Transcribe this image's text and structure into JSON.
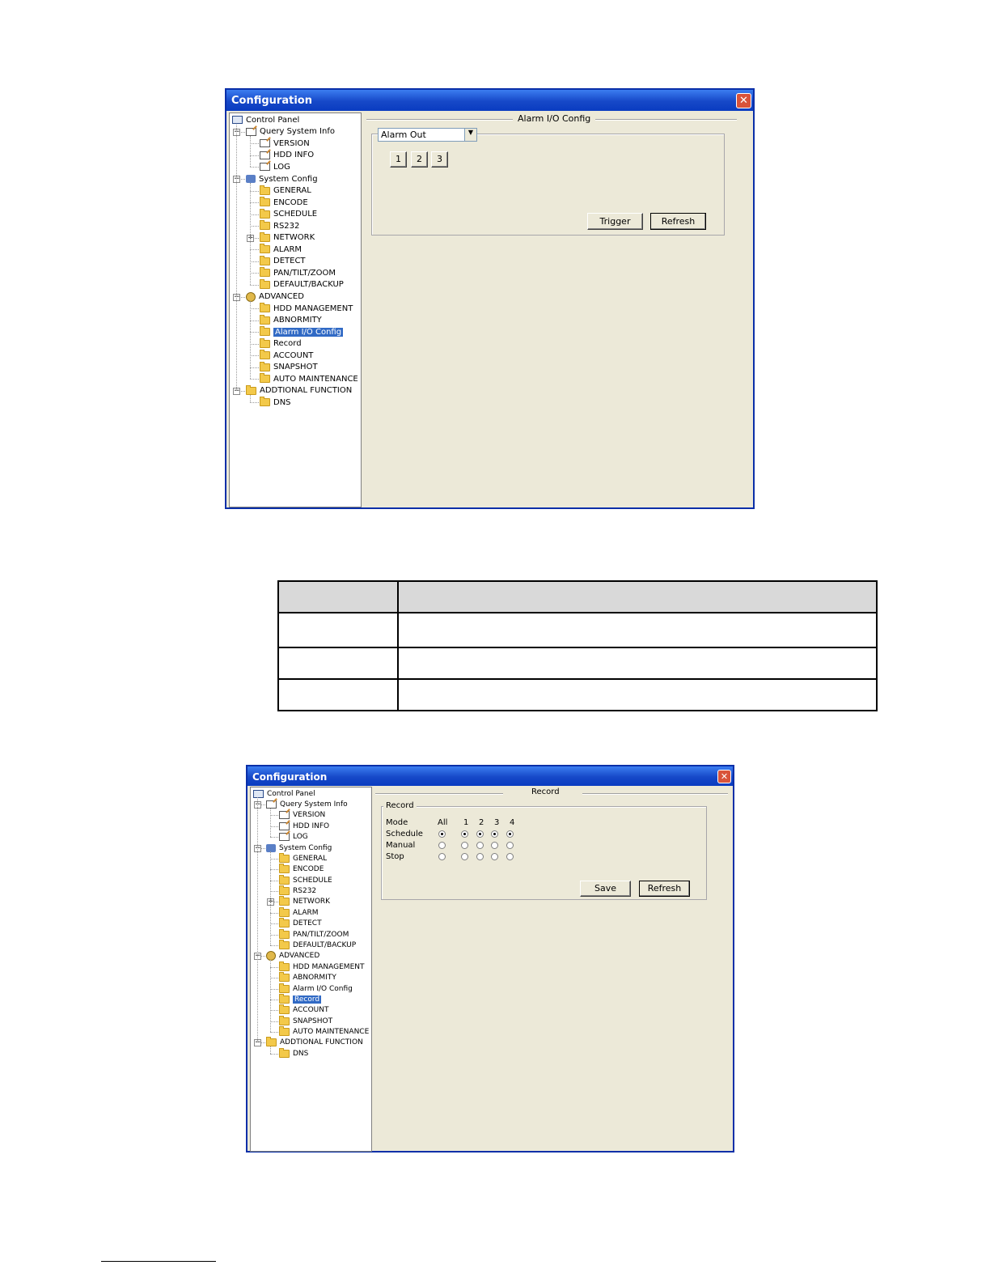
{
  "window1": {
    "title": "Configuration",
    "section_title": "Alarm I/O Config",
    "select_value": "Alarm Out",
    "channel_buttons": [
      "1",
      "2",
      "3"
    ],
    "trigger_label": "Trigger",
    "refresh_label": "Refresh"
  },
  "window2": {
    "title": "Configuration",
    "section_title": "Record",
    "group_label": "Record",
    "col_headers": [
      "Mode",
      "All",
      "1",
      "2",
      "3",
      "4"
    ],
    "rows": [
      {
        "label": "Schedule",
        "selected": true
      },
      {
        "label": "Manual",
        "selected": false
      },
      {
        "label": "Stop",
        "selected": false
      }
    ],
    "save_label": "Save",
    "refresh_label": "Refresh"
  },
  "tree": {
    "root": "Control Panel",
    "query": "Query System Info",
    "version": "VERSION",
    "hdd_info": "HDD INFO",
    "log": "LOG",
    "system_config": "System Config",
    "general": "GENERAL",
    "encode": "ENCODE",
    "schedule": "SCHEDULE",
    "rs232": "RS232",
    "network": "NETWORK",
    "alarm": "ALARM",
    "detect": "DETECT",
    "ptz": "PAN/TILT/ZOOM",
    "default_backup": "DEFAULT/BACKUP",
    "advanced": "ADVANCED",
    "hdd_management": "HDD MANAGEMENT",
    "abnormity": "ABNORMITY",
    "alarm_io": "Alarm I/O Config",
    "record": "Record",
    "account": "ACCOUNT",
    "snapshot": "SNAPSHOT",
    "auto_maintenance": "AUTO MAINTENANCE",
    "additional": "ADDTIONAL FUNCTION",
    "dns": "DNS"
  },
  "colors": {
    "title_blue": "#1648c8",
    "selection": "#316ac5",
    "window_bg": "#ece9d8"
  }
}
